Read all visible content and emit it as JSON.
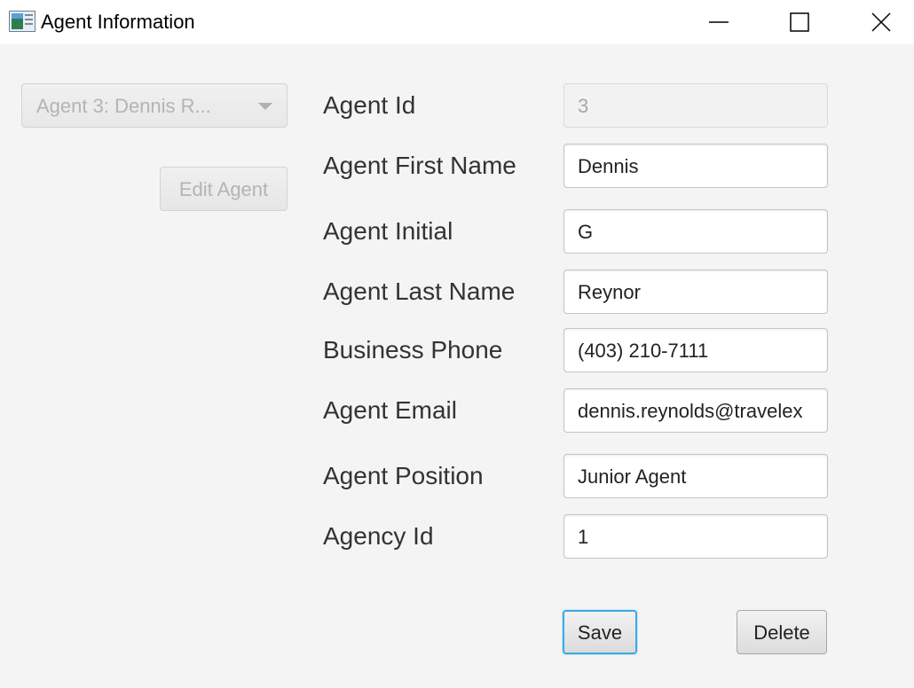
{
  "window": {
    "title": "Agent Information"
  },
  "sidebar": {
    "agent_select": {
      "selected": "Agent 3: Dennis R...",
      "enabled": false
    },
    "edit_button": {
      "label": "Edit Agent",
      "enabled": false
    }
  },
  "form": {
    "fields": [
      {
        "key": "agent_id",
        "label": "Agent Id",
        "value": "3",
        "enabled": false
      },
      {
        "key": "first_name",
        "label": "Agent First Name",
        "value": "Dennis",
        "enabled": true
      },
      {
        "key": "initial",
        "label": "Agent Initial",
        "value": "G",
        "enabled": true
      },
      {
        "key": "last_name",
        "label": "Agent Last Name",
        "value": "Reynor",
        "enabled": true
      },
      {
        "key": "business_phone",
        "label": "Business Phone",
        "value": "(403) 210-7111",
        "enabled": true
      },
      {
        "key": "email",
        "label": "Agent Email",
        "value": "dennis.reynolds@travelex",
        "enabled": true
      },
      {
        "key": "position",
        "label": "Agent Position",
        "value": "Junior Agent",
        "enabled": true
      },
      {
        "key": "agency_id",
        "label": "Agency Id",
        "value": "1",
        "enabled": true
      }
    ]
  },
  "actions": {
    "save_label": "Save",
    "delete_label": "Delete"
  },
  "colors": {
    "focus_accent": "#3fa9e0",
    "background": "#f4f4f4"
  }
}
